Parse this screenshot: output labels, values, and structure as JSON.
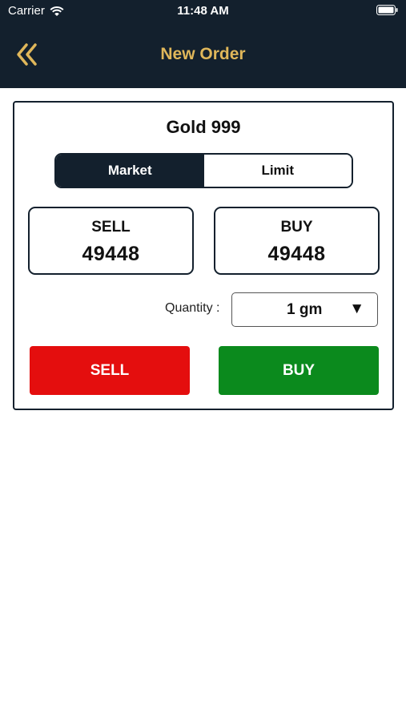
{
  "status_bar": {
    "carrier": "Carrier",
    "time": "11:48 AM"
  },
  "nav": {
    "title": "New Order",
    "back_icon": "double-chevron-left-icon"
  },
  "product": {
    "title": "Gold 999"
  },
  "order_type": {
    "options": [
      "Market",
      "Limit"
    ],
    "selected": "Market"
  },
  "prices": {
    "sell_label": "SELL",
    "sell_value": "49448",
    "buy_label": "BUY",
    "buy_value": "49448"
  },
  "quantity": {
    "label": "Quantity :",
    "value": "1 gm",
    "caret": "▼"
  },
  "actions": {
    "sell_label": "SELL",
    "buy_label": "BUY"
  },
  "colors": {
    "header_bg": "#13202d",
    "title_gold": "#e0b75a",
    "sell_red": "#e40e0e",
    "buy_green": "#0b8a1d"
  }
}
